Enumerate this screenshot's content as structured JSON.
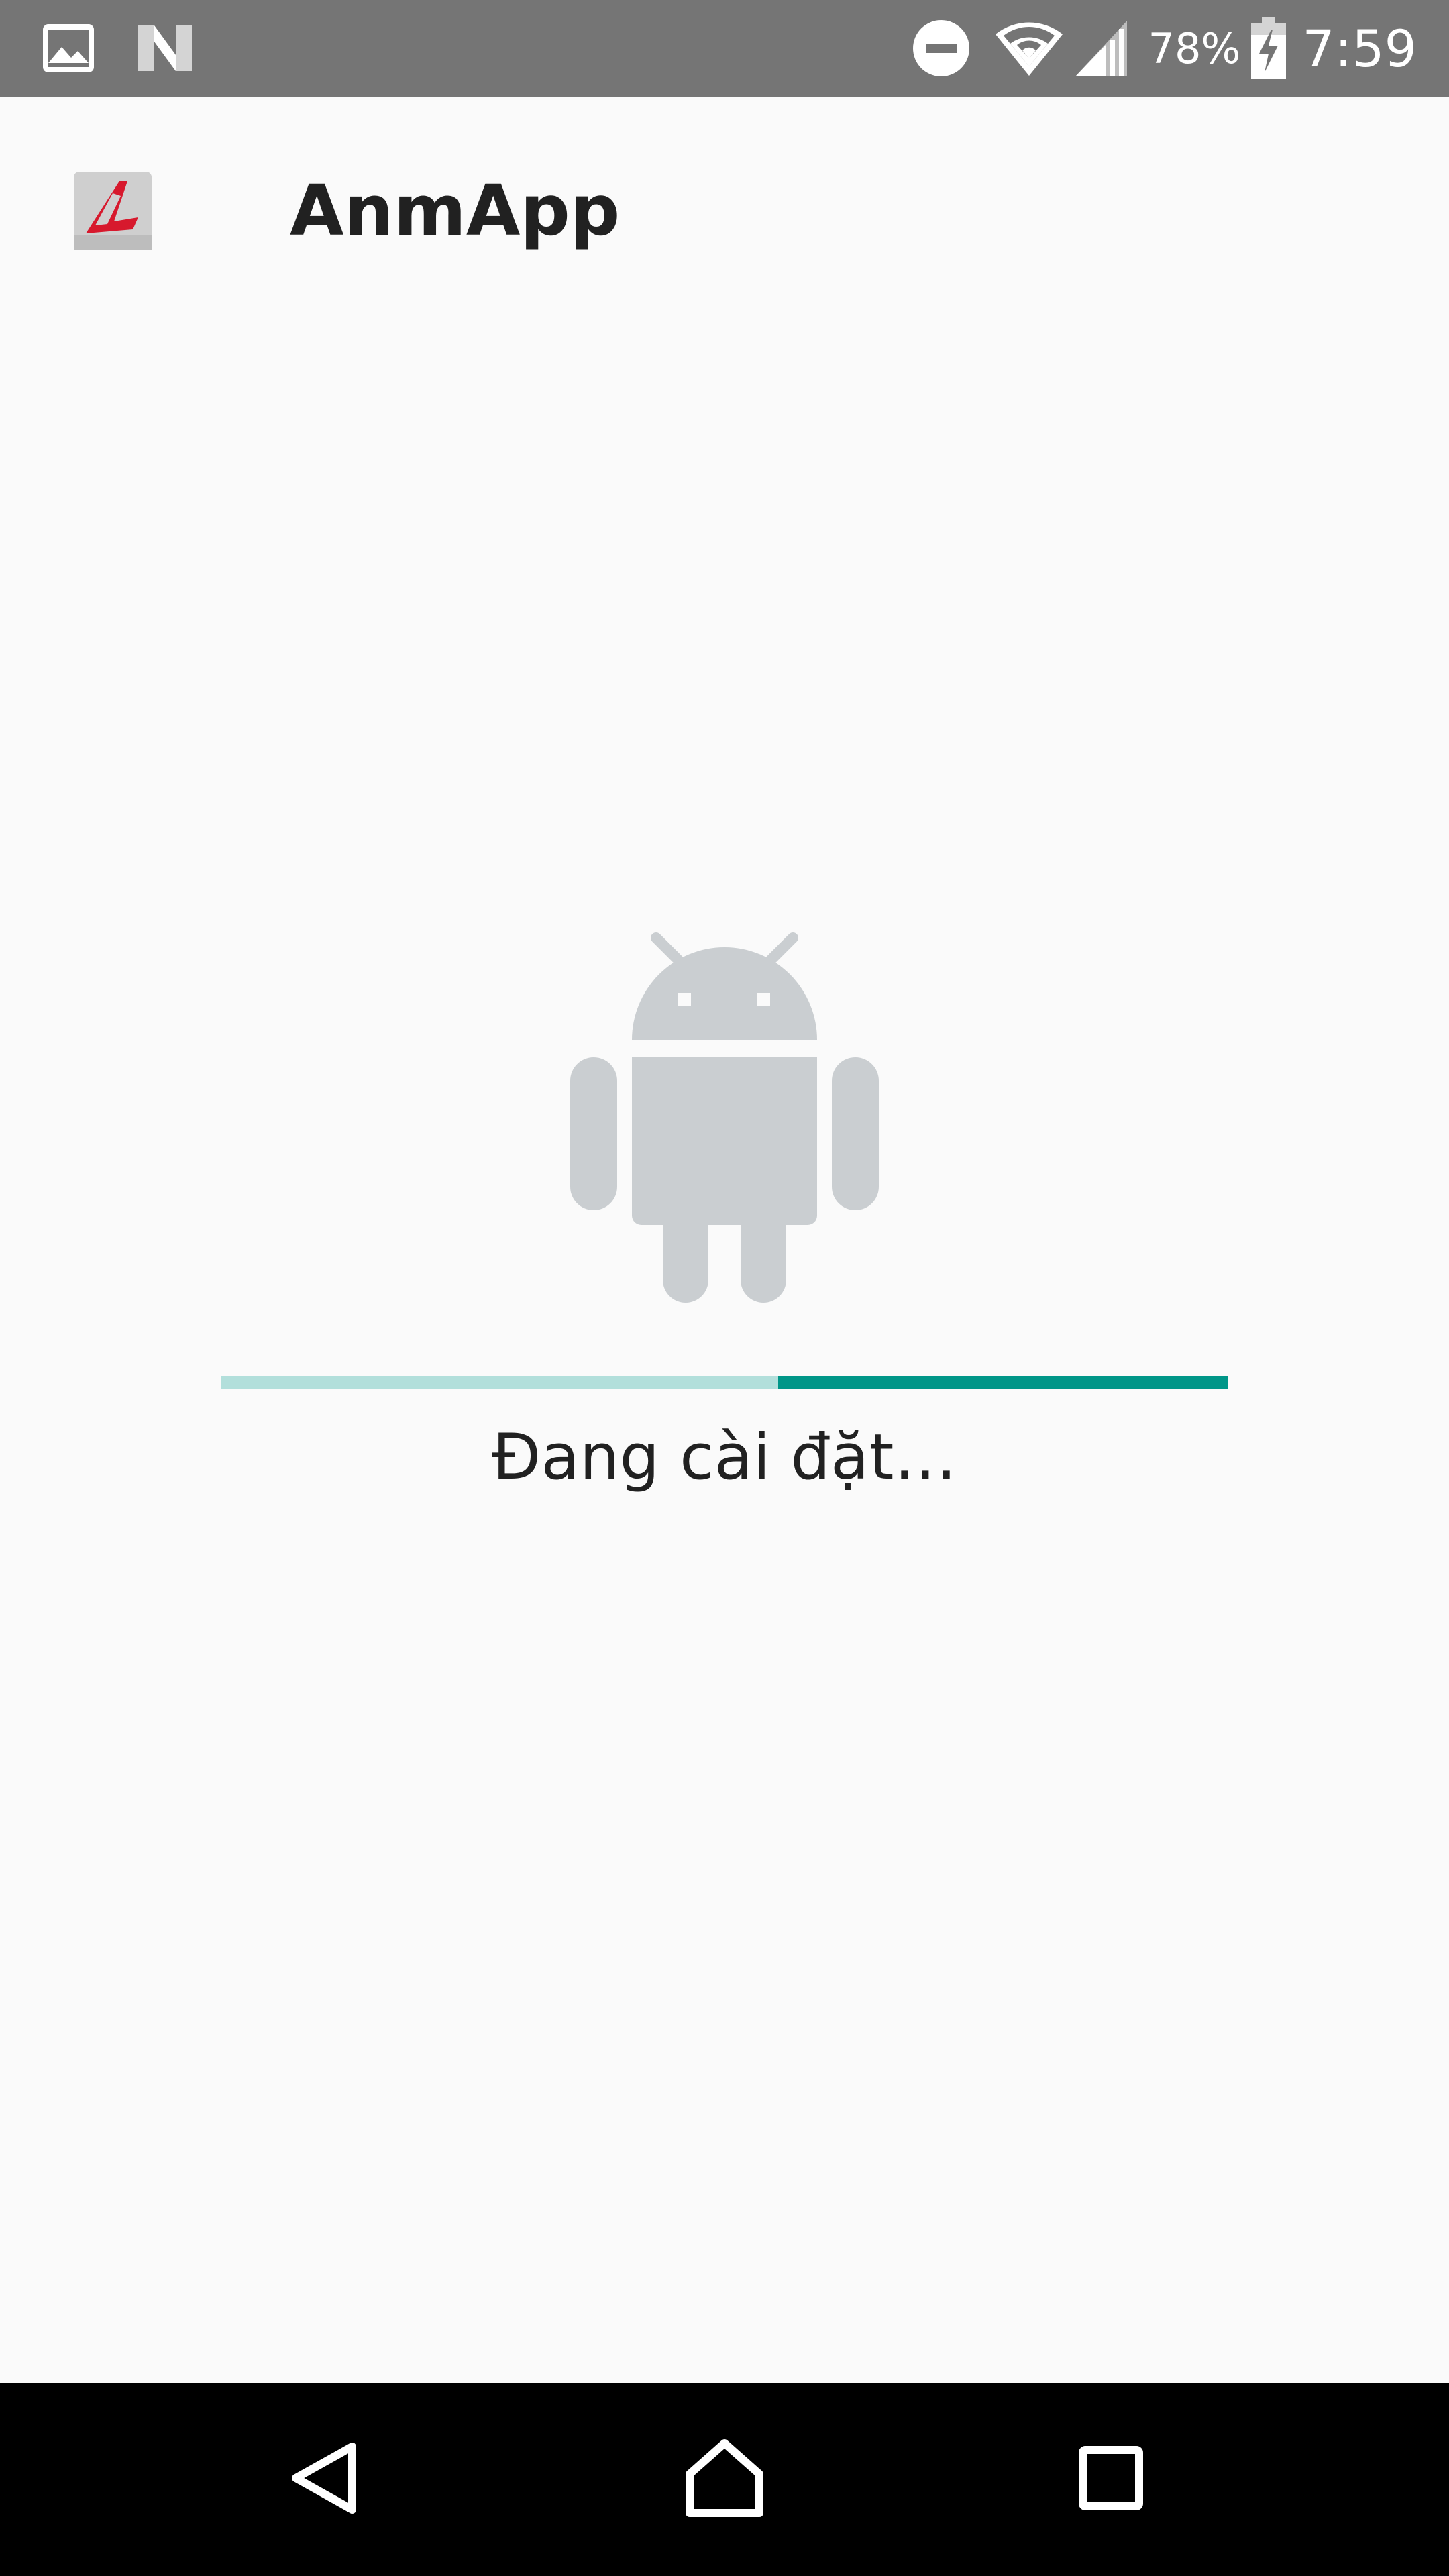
{
  "status_bar": {
    "battery_percent": "78%",
    "time": "7:59",
    "icons": [
      "image-notification-icon",
      "n-notification-icon",
      "do-not-disturb-icon",
      "wifi-icon",
      "cell-signal-icon",
      "battery-charging-icon"
    ]
  },
  "app": {
    "title": "AnmApp",
    "icon": "anmapp-logo-icon"
  },
  "install": {
    "status_text": "Đang cài đặt…",
    "icon": "android-robot-icon"
  },
  "colors": {
    "status_bar_bg": "#757575",
    "progress_track": "#b2dfdb",
    "progress_indicator": "#009688",
    "robot": "#caced1",
    "logo_red": "#d7192d"
  },
  "nav_bar": {
    "buttons": [
      "back-icon",
      "home-icon",
      "recents-icon"
    ]
  }
}
